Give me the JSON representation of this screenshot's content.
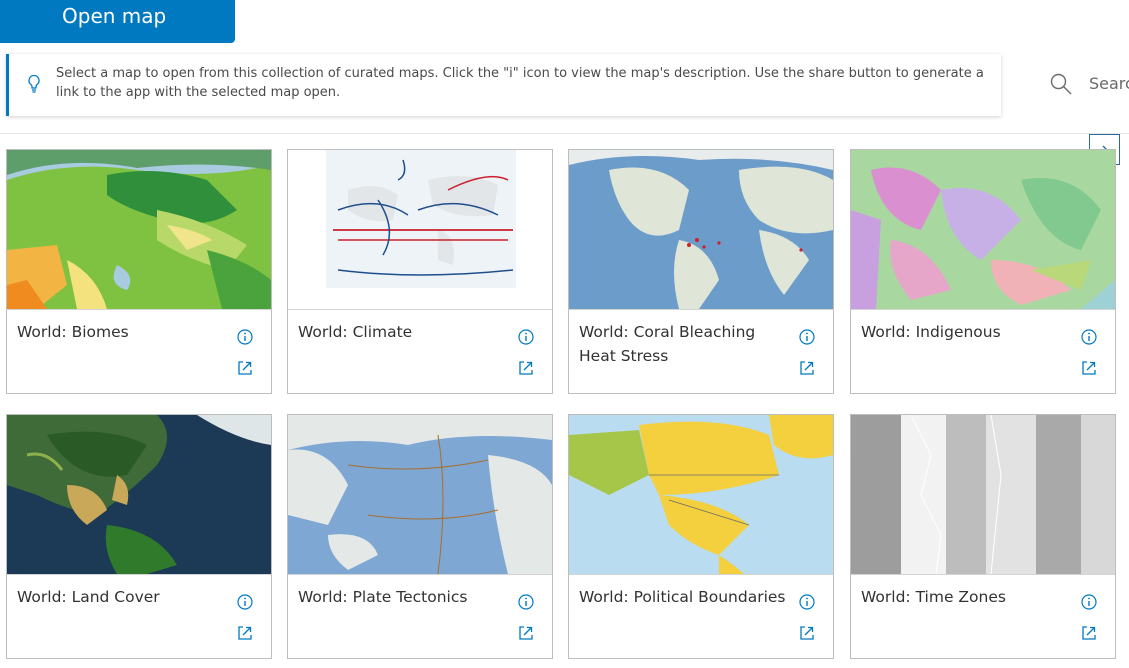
{
  "header": {
    "open_map_label": "Open map"
  },
  "notice": {
    "text": "Select a map to open from this collection of curated maps. Click the \"i\" icon to view the map's description. Use the share button to generate a link to the app with the selected map open."
  },
  "search": {
    "placeholder": "Searc"
  },
  "colors": {
    "accent": "#0079c1",
    "border": "#bdbdbd"
  },
  "icons": {
    "info": "info-icon",
    "share": "share-icon",
    "search": "search-icon",
    "notice": "lightbulb-icon",
    "next": "chevron-right-icon"
  },
  "cards": [
    {
      "title": "World: Biomes"
    },
    {
      "title": "World: Climate"
    },
    {
      "title": "World: Coral Bleaching Heat Stress"
    },
    {
      "title": "World: Indigenous"
    },
    {
      "title": "World: Land Cover"
    },
    {
      "title": "World: Plate Tectonics"
    },
    {
      "title": "World: Political Boundaries"
    },
    {
      "title": "World: Time Zones"
    }
  ]
}
